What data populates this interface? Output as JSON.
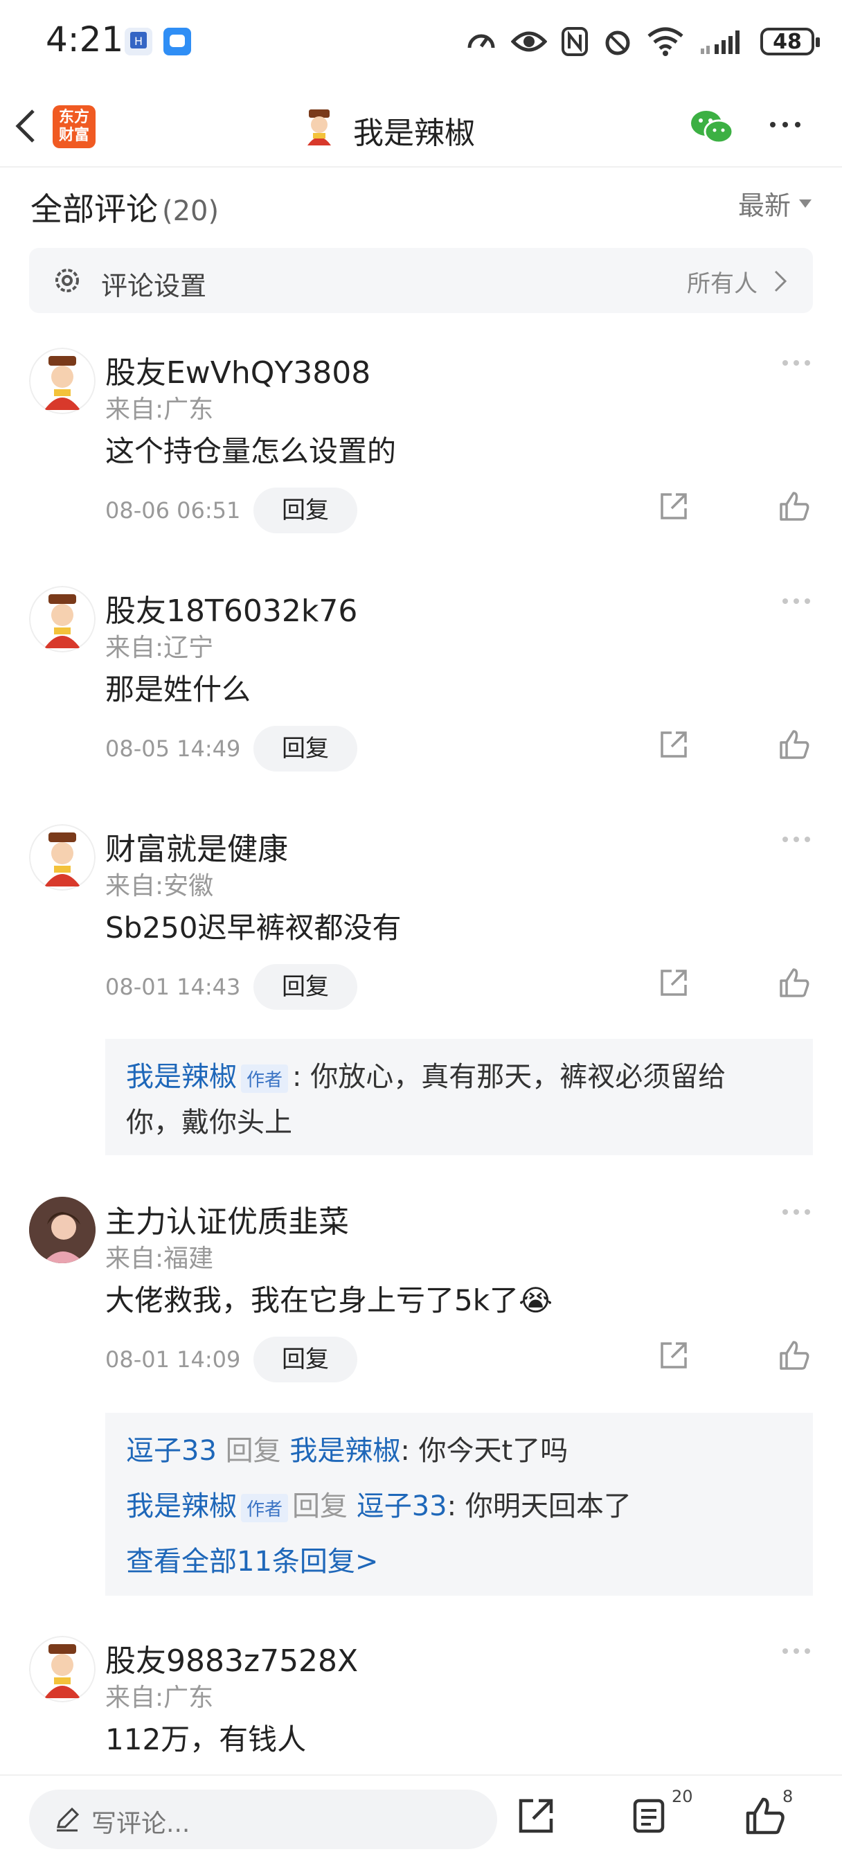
{
  "status_bar": {
    "time": "4:21",
    "battery": "48"
  },
  "header": {
    "logo_line1": "东方",
    "logo_line2": "财富",
    "title": "我是辣椒"
  },
  "section": {
    "title": "全部评论",
    "count": "(20)",
    "sort_label": "最新"
  },
  "settings": {
    "label": "评论设置",
    "value": "所有人"
  },
  "comments": [
    {
      "username": "股友EwVhQY3808",
      "location": "来自:广东",
      "content": "这个持仓量怎么设置的",
      "time": "08-06 06:51",
      "reply_label": "回复"
    },
    {
      "username": "股友18T6032k76",
      "location": "来自:辽宁",
      "content": "那是姓什么",
      "time": "08-05 14:49",
      "reply_label": "回复"
    },
    {
      "username": "财富就是健康",
      "location": "来自:安徽",
      "content": "Sb250迟早裤衩都没有",
      "time": "08-01 14:43",
      "reply_label": "回复",
      "reply": {
        "user": "我是辣椒",
        "tag": "作者",
        "line1": ": 你放心，真有那天，裤衩必须留给",
        "line2": "你，戴你头上"
      }
    },
    {
      "username": "主力认证优质韭菜",
      "location": "来自:福建",
      "content": "大佬救我，我在它身上亏了5k了",
      "emoji": "😭",
      "time": "08-01 14:09",
      "reply_label": "回复",
      "replies": [
        {
          "user": "逗子33",
          "verb": "回复",
          "target": "我是辣椒",
          "text": ": 你今天t了吗"
        },
        {
          "user": "我是辣椒",
          "tag": "作者",
          "verb": "回复",
          "target": "逗子33",
          "text": ": 你明天回本了"
        }
      ],
      "view_all": "查看全部11条回复>"
    },
    {
      "username": "股友9883z7528X",
      "location": "来自:广东",
      "content": "112万，有钱人"
    }
  ],
  "bottom_bar": {
    "placeholder": "写评论...",
    "comment_count": "20",
    "like_count": "8"
  },
  "colors": {
    "brand": "#f05a22",
    "link_blue": "#1e67b9",
    "reply_bg": "#f5f6f8"
  }
}
